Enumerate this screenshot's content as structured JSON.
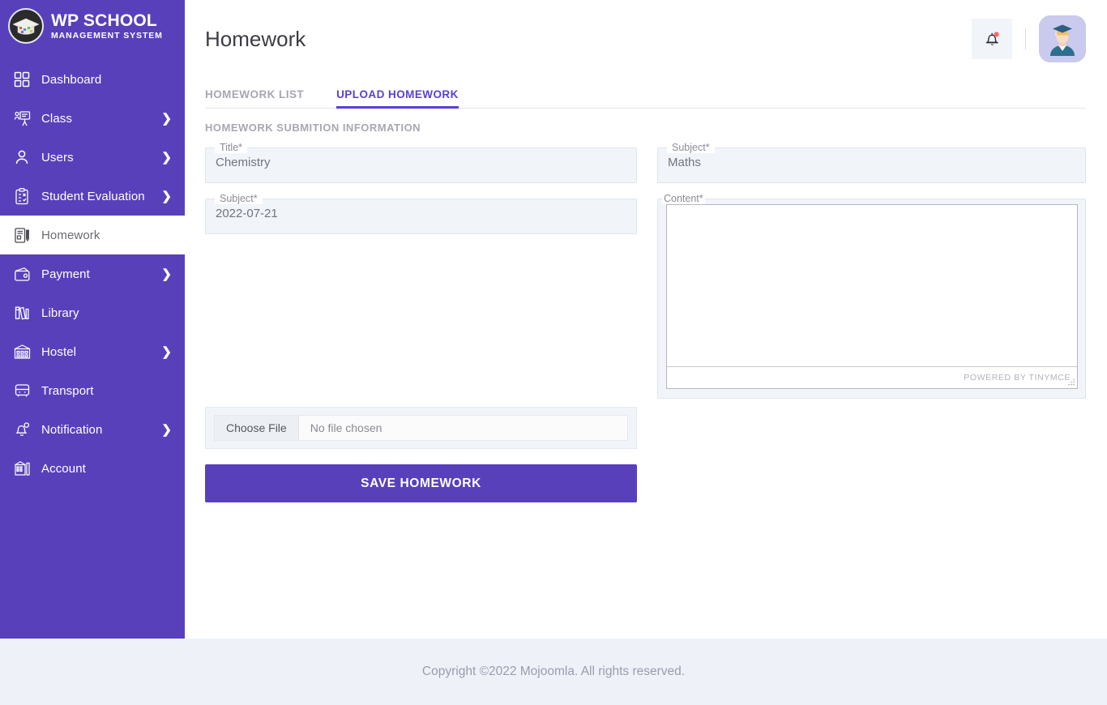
{
  "brand": {
    "title": "WP SCHOOL",
    "subtitle": "MANAGEMENT SYSTEM",
    "logo_icon": "graduation-cap-logo-icon",
    "sidebar_color": "#5940bb"
  },
  "sidebar": {
    "items": [
      {
        "label": "Dashboard",
        "icon": "grid-dashboard-icon",
        "has_chevron": false,
        "active": false
      },
      {
        "label": "Class",
        "icon": "teacher-board-icon",
        "has_chevron": true,
        "active": false
      },
      {
        "label": "Users",
        "icon": "user-person-icon",
        "has_chevron": true,
        "active": false
      },
      {
        "label": "Student Evaluation",
        "icon": "clipboard-check-icon",
        "has_chevron": true,
        "active": false
      },
      {
        "label": "Homework",
        "icon": "document-pencil-icon",
        "has_chevron": false,
        "active": true
      },
      {
        "label": "Payment",
        "icon": "wallet-icon",
        "has_chevron": true,
        "active": false
      },
      {
        "label": "Library",
        "icon": "books-shelf-icon",
        "has_chevron": false,
        "active": false
      },
      {
        "label": "Hostel",
        "icon": "building-hostel-icon",
        "has_chevron": true,
        "active": false
      },
      {
        "label": "Transport",
        "icon": "bus-icon",
        "has_chevron": false,
        "active": false
      },
      {
        "label": "Notification",
        "icon": "bell-notification-icon",
        "has_chevron": true,
        "active": false
      },
      {
        "label": "Account",
        "icon": "bank-account-icon",
        "has_chevron": false,
        "active": false
      }
    ],
    "chevron_glyph": "❯"
  },
  "header": {
    "title": "Homework",
    "bell_icon": "bell-icon",
    "bell_badge_color": "#fa6b64",
    "avatar_icon": "graduate-student-avatar-icon"
  },
  "tabs": [
    {
      "label": "HOMEWORK LIST",
      "active": false
    },
    {
      "label": "UPLOAD HOMEWORK",
      "active": true
    }
  ],
  "accent_color": "#5a3fd6",
  "section": {
    "title": "HOMEWORK SUBMITION INFORMATION"
  },
  "form": {
    "left": [
      {
        "legend": "Title*",
        "value": "Chemistry"
      },
      {
        "legend": "Subject*",
        "value": "2022-07-21"
      }
    ],
    "right_field": {
      "legend": "Subject*",
      "value": "Maths"
    },
    "content_field": {
      "legend": "Content*",
      "value": "",
      "status_text": "POWERED BY TINYMCE",
      "resize_grip_icon": "resize-grip-icon"
    },
    "file_input": {
      "button_label": "Choose File",
      "file_name": "No file chosen"
    },
    "save_label": "SAVE HOMEWORK"
  },
  "footer": {
    "text": "Copyright ©2022 Mojoomla. All rights reserved."
  }
}
